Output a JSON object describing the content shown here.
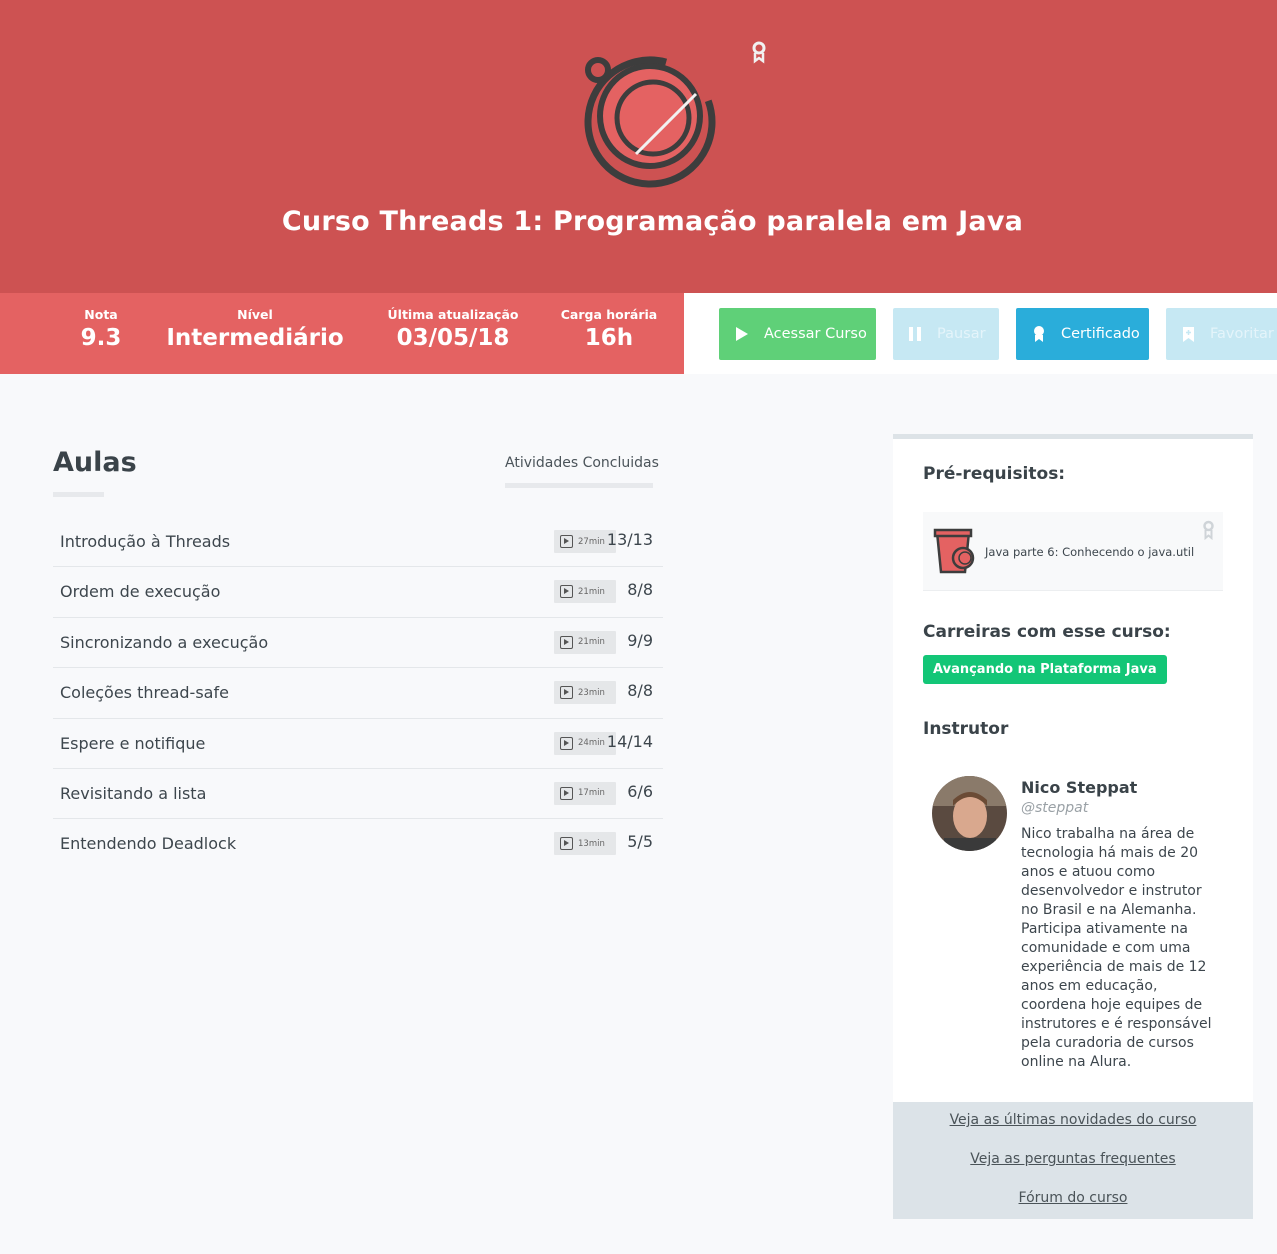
{
  "course": {
    "title": "Curso Threads 1: Programação paralela em Java"
  },
  "stats": [
    {
      "label": "Nota",
      "value": "9.3"
    },
    {
      "label": "Nível",
      "value": "Intermediário"
    },
    {
      "label": "Última atualização",
      "value": "03/05/18"
    },
    {
      "label": "Carga horária",
      "value": "16h"
    }
  ],
  "actions": {
    "access": "Acessar Curso",
    "pause": "Pausar",
    "certificate": "Certificado",
    "favorite": "Favoritar"
  },
  "lessons_section": {
    "title": "Aulas",
    "activities_label": "Atividades Concluidas"
  },
  "lessons": [
    {
      "name": "Introdução à Threads",
      "duration": "27min",
      "progress": "13/13"
    },
    {
      "name": "Ordem de execução",
      "duration": "21min",
      "progress": "8/8"
    },
    {
      "name": "Sincronizando a execução",
      "duration": "21min",
      "progress": "9/9"
    },
    {
      "name": "Coleções thread-safe",
      "duration": "23min",
      "progress": "8/8"
    },
    {
      "name": "Espere e notifique",
      "duration": "24min",
      "progress": "14/14"
    },
    {
      "name": "Revisitando a lista",
      "duration": "17min",
      "progress": "6/6"
    },
    {
      "name": "Entendendo Deadlock",
      "duration": "13min",
      "progress": "5/5"
    }
  ],
  "sidebar": {
    "prereq_heading": "Pré-requisitos:",
    "prereq_course": "Java parte 6: Conhecendo o java.util",
    "careers_heading": "Carreiras com esse curso:",
    "career": "Avançando na Plataforma Java",
    "instructor_heading": "Instrutor",
    "instructor_name": "Nico Steppat",
    "instructor_handle": "@steppat",
    "instructor_bio": "Nico trabalha na área de tecnologia há mais de 20 anos e atuou como desenvolvedor e instrutor no Brasil e na Alemanha. Participa ativamente na comunidade e com uma experiência de mais de 12 anos em educação, coordena hoje equipes de instrutores e é responsável pela curadoria de cursos online na Alura.",
    "links": [
      "Veja as últimas novidades do curso",
      "Veja as perguntas frequentes",
      "Fórum do curso"
    ]
  },
  "colors": {
    "hero": "#cd5252",
    "stats_bar": "#e46262",
    "access_button": "#5fd078",
    "certificate_button": "#2aadda",
    "career_tag": "#13c677"
  }
}
